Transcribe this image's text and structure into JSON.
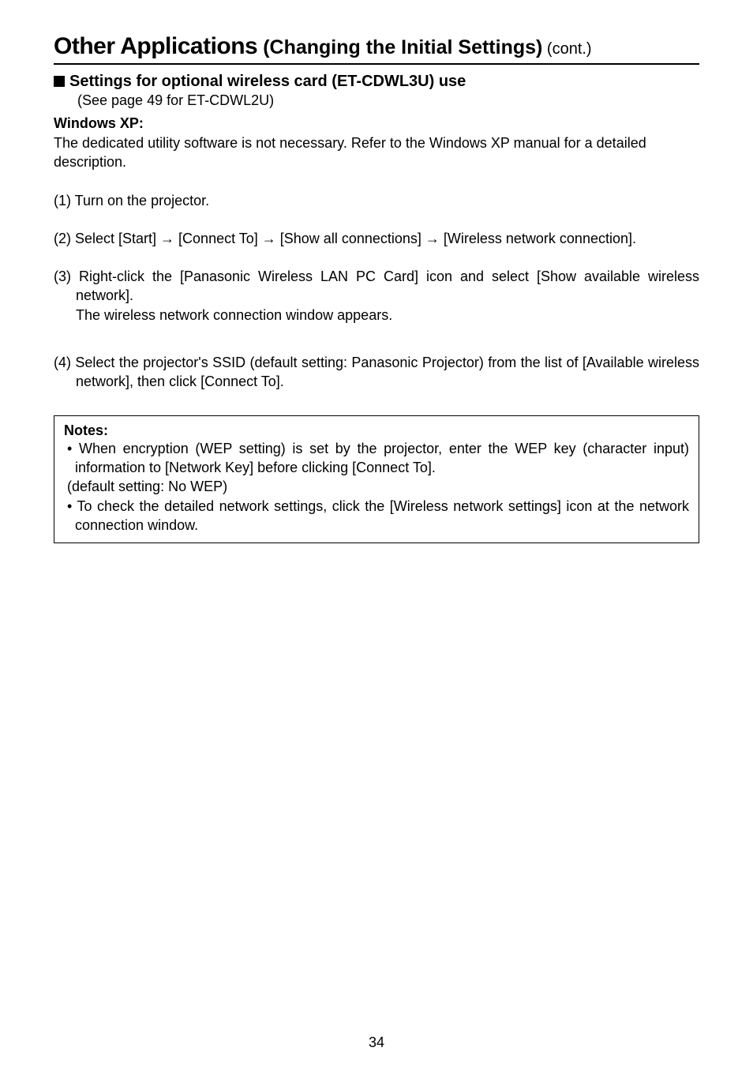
{
  "title": {
    "main": "Other Applications",
    "sub": " (Changing the Initial Settings)",
    "cont": " (cont.)"
  },
  "section": {
    "heading": "Settings for optional wireless card (ET-CDWL3U) use",
    "seePage": "(See page 49 for ET-CDWL2U)"
  },
  "winxp": {
    "label": "Windows XP:",
    "desc": "The dedicated utility software is not necessary. Refer to the Windows XP manual for a detailed description."
  },
  "steps": {
    "s1": "(1) Turn on the projector.",
    "s2": "(2) Select [Start] → [Connect To] → [Show all connections] → [Wireless network connection].",
    "s3a": "(3) Right-click the [Panasonic Wireless LAN PC Card] icon and select [Show available wireless network].",
    "s3b": "The wireless network connection window appears.",
    "s4": "(4) Select the projector's SSID (default setting: Panasonic Projector) from the list of [Available wireless network], then click [Connect To]."
  },
  "notes": {
    "title": "Notes:",
    "n1a": "• When encryption (WEP setting) is set by the projector, enter the WEP key (character input) information to [Network Key] before clicking [Connect To].",
    "n1b": "(default setting: No WEP)",
    "n2": "• To check the detailed network settings, click the [Wireless network settings] icon at the network connection window."
  },
  "pageNumber": "34"
}
